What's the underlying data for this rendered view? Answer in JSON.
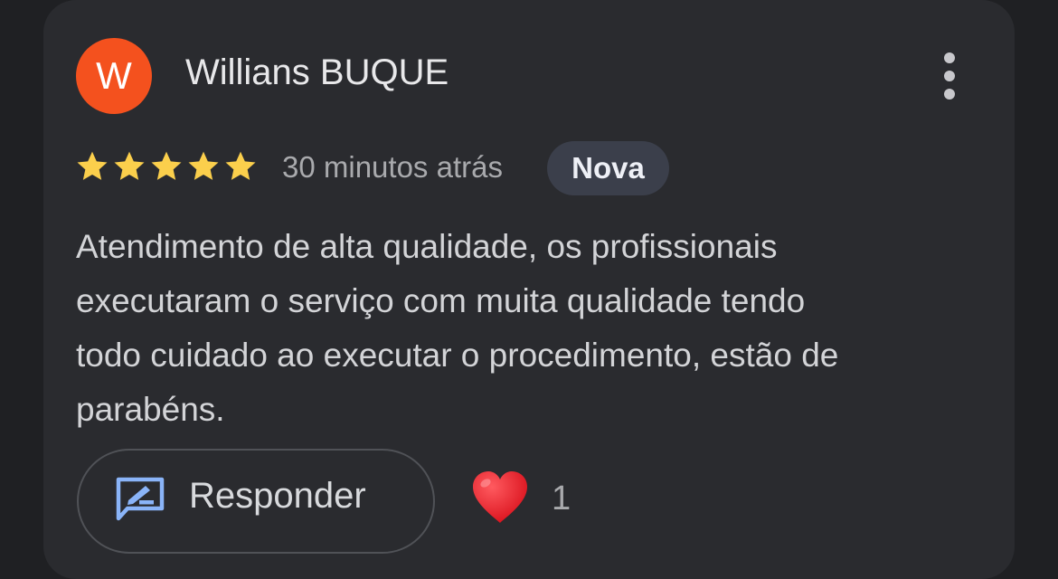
{
  "review": {
    "avatar_letter": "W",
    "avatar_color": "#f4511e",
    "reviewer_name": "Willians BUQUE",
    "rating": 5,
    "rating_max": 5,
    "star_color": "#fbcf4c",
    "timestamp": "30 minutos atrás",
    "badge": "Nova",
    "text_lines": [
      "Atendimento de alta qualidade, os profissionais",
      "executaram o serviço com muita qualidade tendo",
      "todo cuidado ao executar o procedimento, estão de",
      "parabéns."
    ]
  },
  "actions": {
    "reply_label": "Responder",
    "reply_icon": "rate-review-icon",
    "reply_icon_color": "#8ab4f8",
    "more_icon": "more-vert-icon",
    "reaction_icon": "heart-icon",
    "reaction_color": "#e8202e",
    "reaction_count": "1"
  }
}
